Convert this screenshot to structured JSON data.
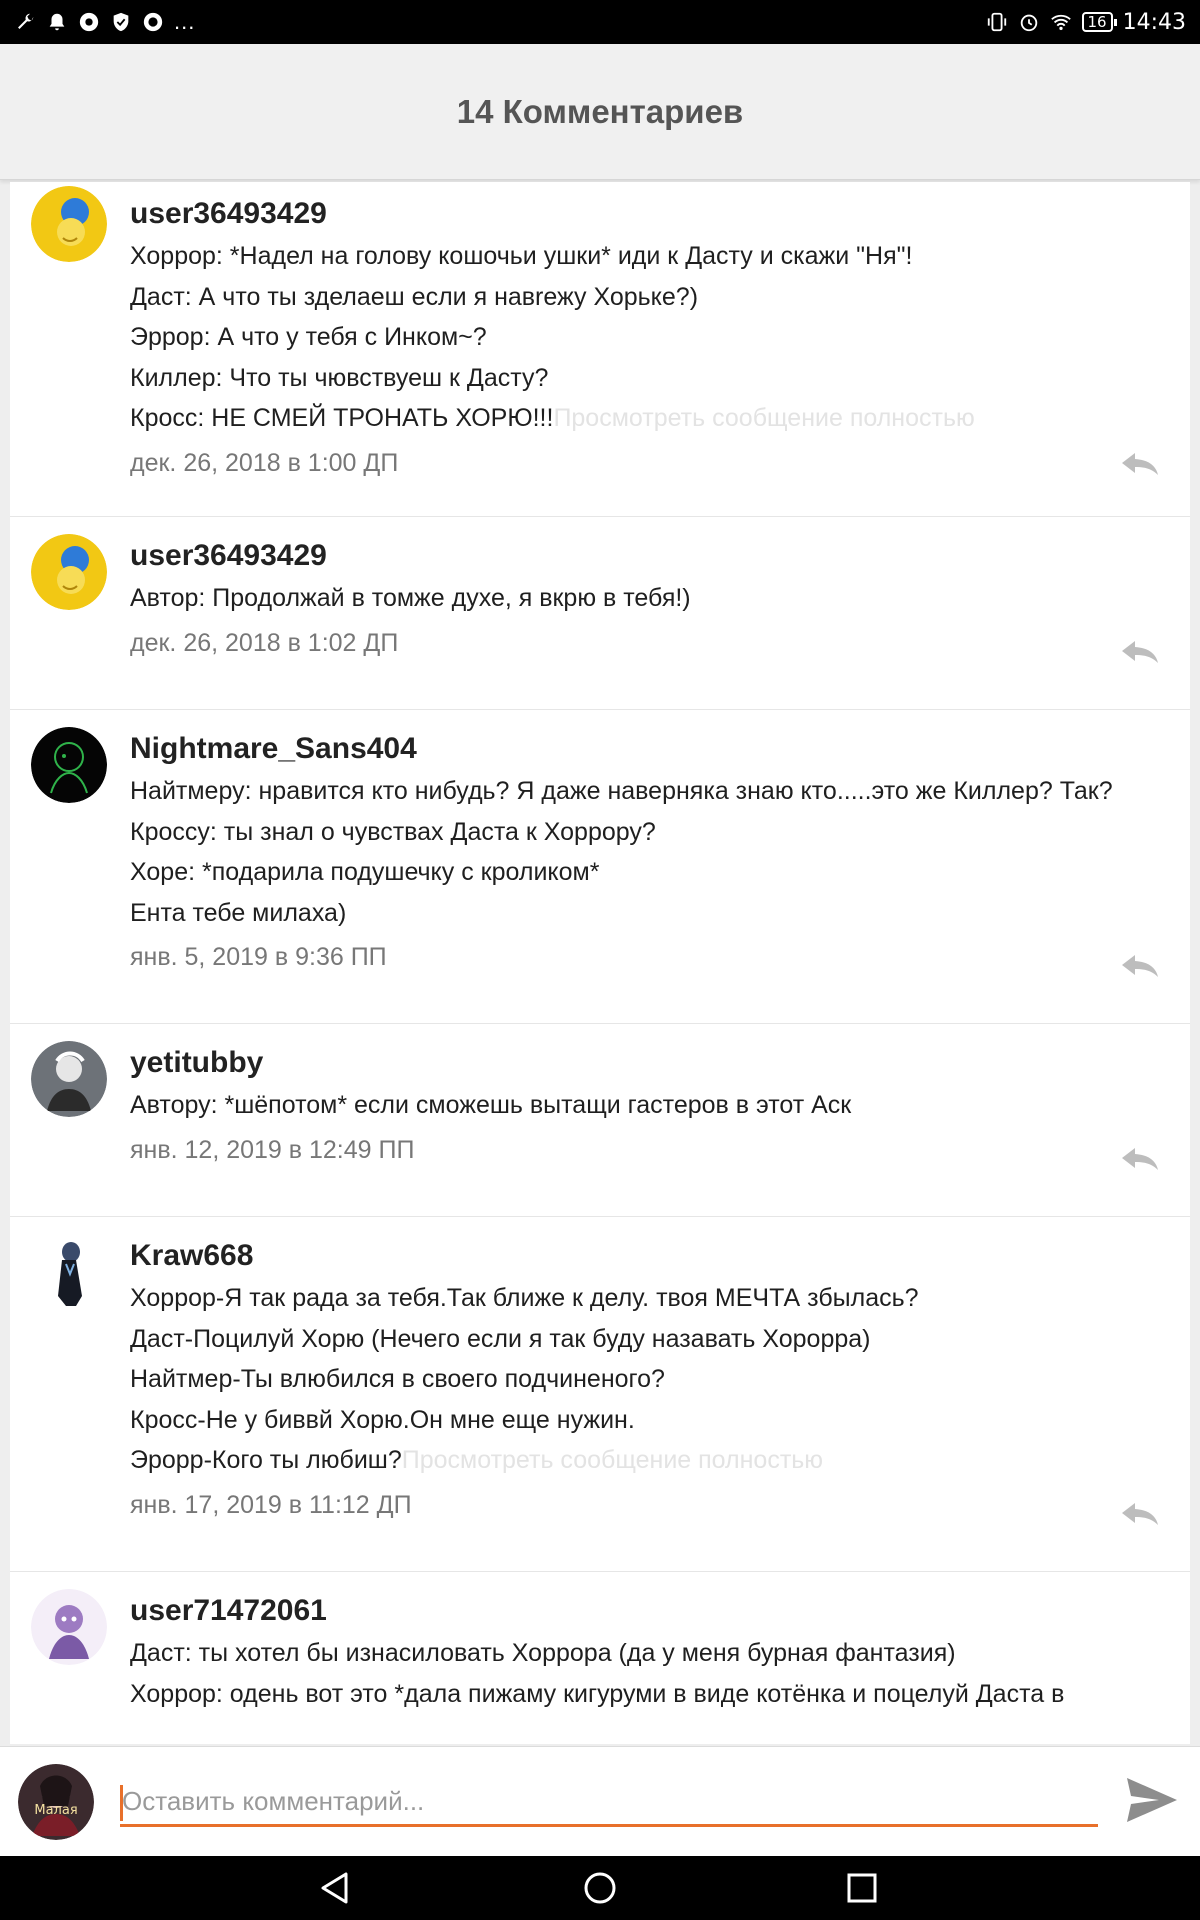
{
  "status_bar": {
    "time": "14:43",
    "battery": "16",
    "left_icons": [
      "wrench-icon",
      "notification-bell-icon",
      "chrome-icon",
      "shield-icon",
      "chat-bubble-icon"
    ],
    "overflow": "...",
    "right_icons": [
      "vibrate-icon",
      "alarm-icon",
      "wifi-icon",
      "battery-icon"
    ]
  },
  "header": {
    "title": "14 Комментариев"
  },
  "comments": [
    {
      "username": "user36493429",
      "lines": [
        "Хоррор: *Надел на голову кошочьи ушки* иди к Дасту и скажи \"Ня\"!",
        "Даст: А что ты зделаеш если я навrежу Хорьке?)",
        "Эррор: А что у тебя с Инком~?",
        "Киллер: Что ты чювствуеш к Дасту?",
        "Кросс: НЕ СМЕЙ ТРОНАТЬ ХОРЮ!!!"
      ],
      "view_full": "Просмотреть сообщение полностью",
      "timestamp": "дек. 26, 2018 в 1:00 ДП"
    },
    {
      "username": "user36493429",
      "lines": [
        "Автор: Продолжай в томже духе, я вкрю в тебя!)"
      ],
      "timestamp": "дек. 26, 2018 в 1:02 ДП"
    },
    {
      "username": "Nightmare_Sans404",
      "lines": [
        "Найтмеру: нравится кто нибудь? Я даже наверняка знаю кто.....это же Киллер? Так?",
        "Кроссу: ты знал о чувствах Даста к Хоррору?",
        "Хоре: *подарила подушечку с кроликом*",
        "Ента тебе милаха)"
      ],
      "timestamp": "янв. 5, 2019 в 9:36 ПП"
    },
    {
      "username": "yetitubby",
      "lines": [
        "Автору: *шёпотом* если сможешь вытащи гастеров в этот Аск"
      ],
      "timestamp": "янв. 12, 2019 в 12:49 ПП"
    },
    {
      "username": "Kraw668",
      "lines": [
        "Хоррор-Я так рада за тебя.Так ближе к делу. твоя МЕЧТА збылась?",
        "Даст-Поцилуй Хорю (Нечего если я так буду назавать Хороррa)",
        "Найтмер-Ты влюбился в своего подчиненого?",
        "Кросс-Не у биввй Хорю.Он мне еще нужин.",
        "Эрорр-Кого ты любиш?"
      ],
      "view_full": "Просмотреть сообщение полностью",
      "timestamp": "янв. 17, 2019 в 11:12 ДП"
    },
    {
      "username": "user71472061",
      "lines": [
        "Даст: ты хотел бы изнасиловать Хоррора (да у меня бурная фантазия)",
        "Хоррор: одень вот это *дала пижаму кигуруми в виде котёнка и поцелуй Даста в"
      ]
    }
  ],
  "input": {
    "placeholder": "Оставить комментарий...",
    "avatar_text": "Малая"
  },
  "colors": {
    "accent": "#e8702a",
    "header_bg": "#f0f0f0",
    "muted_text": "#777777"
  }
}
